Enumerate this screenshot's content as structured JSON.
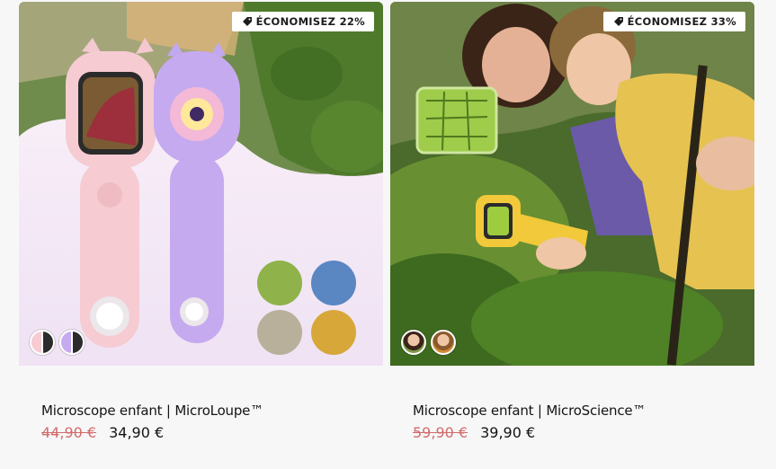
{
  "products": [
    {
      "title": "Microscope enfant | MicroLoupe™",
      "badge": "ÉCONOMISEZ 22%",
      "price_old": "44,90 €",
      "price_new": "34,90 €",
      "swatches": [
        "pink-white microscope",
        "lilac microscope"
      ]
    },
    {
      "title": "Microscope enfant | MicroScience™",
      "badge": "ÉCONOMISEZ 33%",
      "price_old": "59,90 €",
      "price_new": "39,90 €",
      "swatches": [
        "child girl photo",
        "child boy photo"
      ]
    }
  ],
  "colors": {
    "sale_price": "#d36b6b",
    "text": "#141414",
    "background": "#f7f7f8"
  }
}
